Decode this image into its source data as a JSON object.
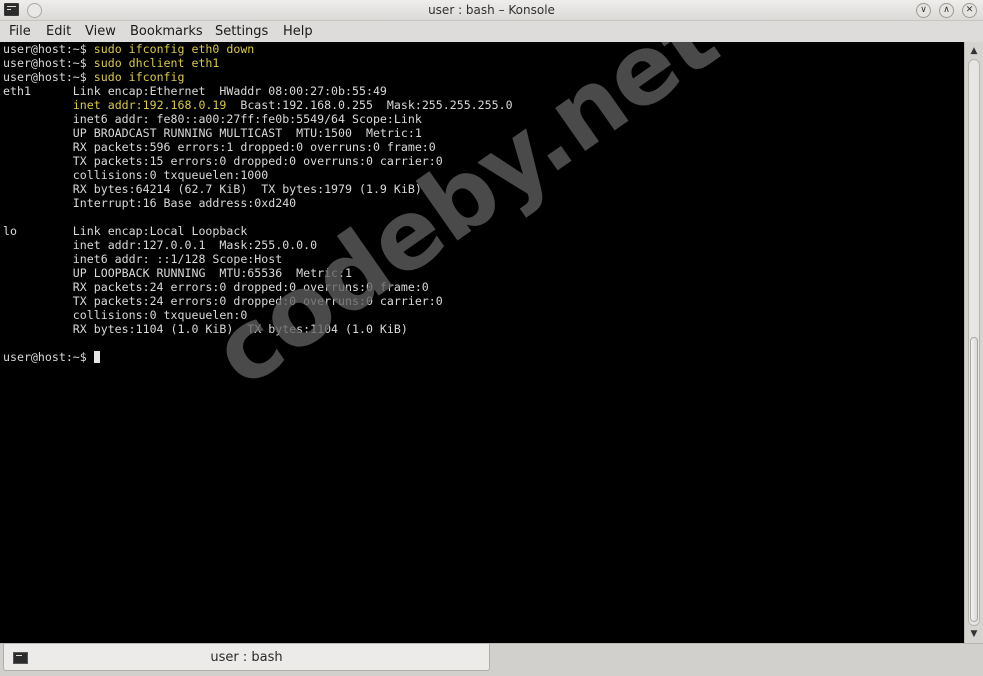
{
  "window": {
    "title": "user : bash – Konsole",
    "icon": "terminal-icon",
    "buttons": {
      "minimize": "∨",
      "maximize": "∧",
      "close": "✕"
    }
  },
  "menubar": {
    "items": [
      "File",
      "Edit",
      "View",
      "Bookmarks",
      "Settings",
      "Help"
    ]
  },
  "terminal": {
    "prompt": "user@host:~$ ",
    "lines": [
      {
        "prompt": "user@host:~$ ",
        "command": "sudo ifconfig eth0 down"
      },
      {
        "prompt": "user@host:~$ ",
        "command": "sudo dhclient eth1"
      },
      {
        "prompt": "user@host:~$ ",
        "command": "sudo ifconfig"
      },
      {
        "text": "eth1      Link encap:Ethernet  HWaddr 08:00:27:0b:55:49"
      },
      {
        "pre": "          ",
        "highlight": "inet addr:192.168.0.19",
        "text": "  Bcast:192.168.0.255  Mask:255.255.255.0"
      },
      {
        "text": "          inet6 addr: fe80::a00:27ff:fe0b:5549/64 Scope:Link"
      },
      {
        "text": "          UP BROADCAST RUNNING MULTICAST  MTU:1500  Metric:1"
      },
      {
        "text": "          RX packets:596 errors:1 dropped:0 overruns:0 frame:0"
      },
      {
        "text": "          TX packets:15 errors:0 dropped:0 overruns:0 carrier:0"
      },
      {
        "text": "          collisions:0 txqueuelen:1000"
      },
      {
        "text": "          RX bytes:64214 (62.7 KiB)  TX bytes:1979 (1.9 KiB)"
      },
      {
        "text": "          Interrupt:16 Base address:0xd240"
      },
      {
        "text": ""
      },
      {
        "text": "lo        Link encap:Local Loopback"
      },
      {
        "text": "          inet addr:127.0.0.1  Mask:255.0.0.0"
      },
      {
        "text": "          inet6 addr: ::1/128 Scope:Host"
      },
      {
        "text": "          UP LOOPBACK RUNNING  MTU:65536  Metric:1"
      },
      {
        "text": "          RX packets:24 errors:0 dropped:0 overruns:0 frame:0"
      },
      {
        "text": "          TX packets:24 errors:0 dropped:0 overruns:0 carrier:0"
      },
      {
        "text": "          collisions:0 txqueuelen:0"
      },
      {
        "text": "          RX bytes:1104 (1.0 KiB)  TX bytes:1104 (1.0 KiB)"
      },
      {
        "text": ""
      },
      {
        "prompt": "user@host:~$ ",
        "command": "",
        "cursor": true
      }
    ],
    "colors": {
      "background": "#000000",
      "text": "#d9d9d9",
      "command": "#d8c94a"
    }
  },
  "watermark": "codeby.net",
  "tabs": [
    {
      "label": "user : bash",
      "icon": "terminal-icon",
      "active": true
    }
  ]
}
